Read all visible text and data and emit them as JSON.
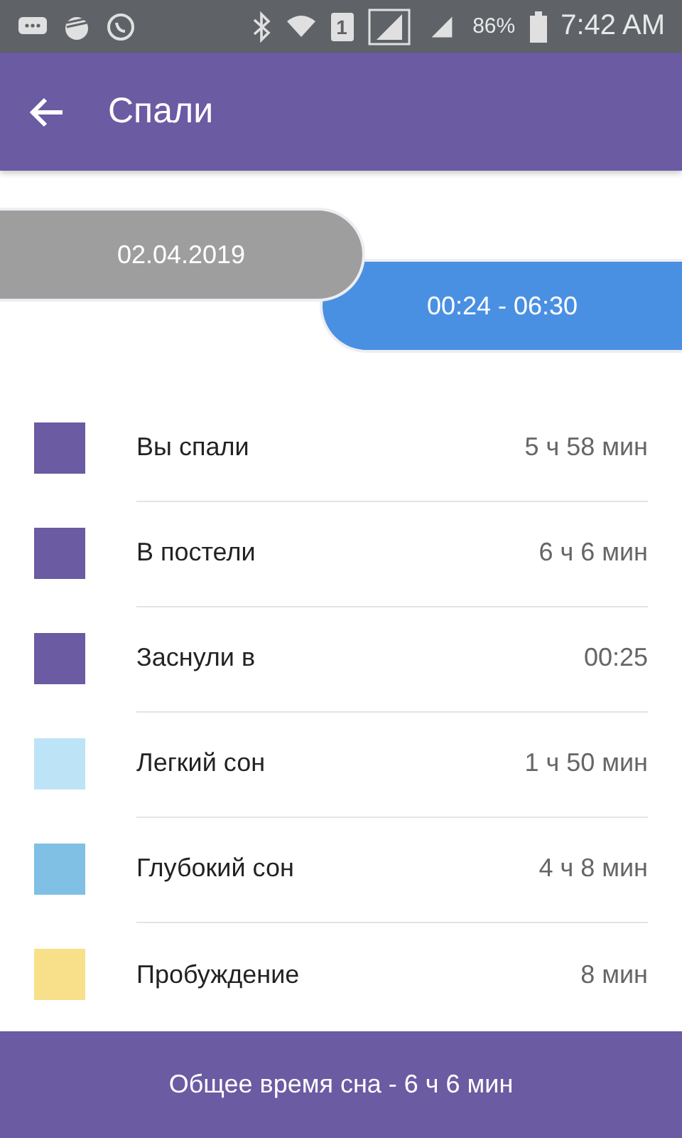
{
  "status_bar": {
    "sim_label": "1",
    "battery": "86%",
    "time": "7:42 AM"
  },
  "app_bar": {
    "title": "Спали"
  },
  "date_pill": {
    "date": "02.04.2019"
  },
  "time_pill": {
    "range": "00:24 - 06:30"
  },
  "stats": [
    {
      "label": "Вы спали",
      "value": "5 ч 58 мин",
      "color": "#6a5ba3"
    },
    {
      "label": "В постели",
      "value": "6 ч 6 мин",
      "color": "#6a5ba3"
    },
    {
      "label": "Заснули в",
      "value": "00:25",
      "color": "#6a5ba3"
    },
    {
      "label": "Легкий сон",
      "value": "1 ч 50 мин",
      "color": "#bde3f6"
    },
    {
      "label": "Глубокий сон",
      "value": "4 ч 8 мин",
      "color": "#7fc0e4"
    },
    {
      "label": "Пробуждение",
      "value": "8 мин",
      "color": "#f8e08a"
    }
  ],
  "footer": {
    "text": "Общее время сна - 6 ч 6 мин"
  }
}
